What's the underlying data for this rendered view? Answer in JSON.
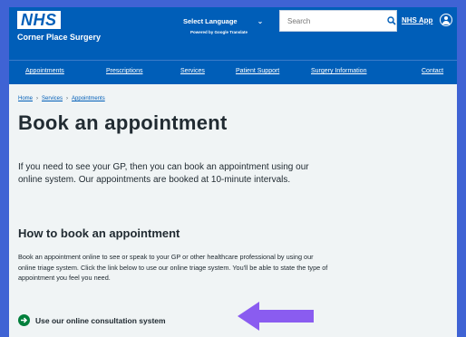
{
  "header": {
    "logo": "NHS",
    "practice_name": "Corner Place Surgery",
    "language_label": "Select Language",
    "language_chevron": "⌄",
    "powered_by": "Powered by Google Translate",
    "search_placeholder": "Search",
    "nhs_app_link": "NHS App",
    "icons": [
      "search-icon",
      "user-icon"
    ]
  },
  "nav": {
    "items": [
      "Appointments",
      "Prescriptions",
      "Services",
      "Patient Support",
      "Surgery Information",
      "Contact"
    ]
  },
  "breadcrumb": [
    "Home",
    "Services",
    "Appointments"
  ],
  "page": {
    "title": "Book an appointment",
    "lead": "If you need to see your GP, then you can book an appointment using our online system. Our appointments are booked at 10-minute intervals.",
    "section_heading": "How to book an appointment",
    "body": "Book an appointment online to see or speak to your GP or other healthcare professional by using our online triage system. Click the link below to use our online triage system. You'll be able to state the type of appointment you feel you need.",
    "action_link": "Use our online consultation system"
  },
  "colors": {
    "nhs_blue": "#005eb8",
    "frame_blue": "#3f63d4",
    "action_green": "#007f3b",
    "arrow_purple": "#8a5cf0"
  }
}
